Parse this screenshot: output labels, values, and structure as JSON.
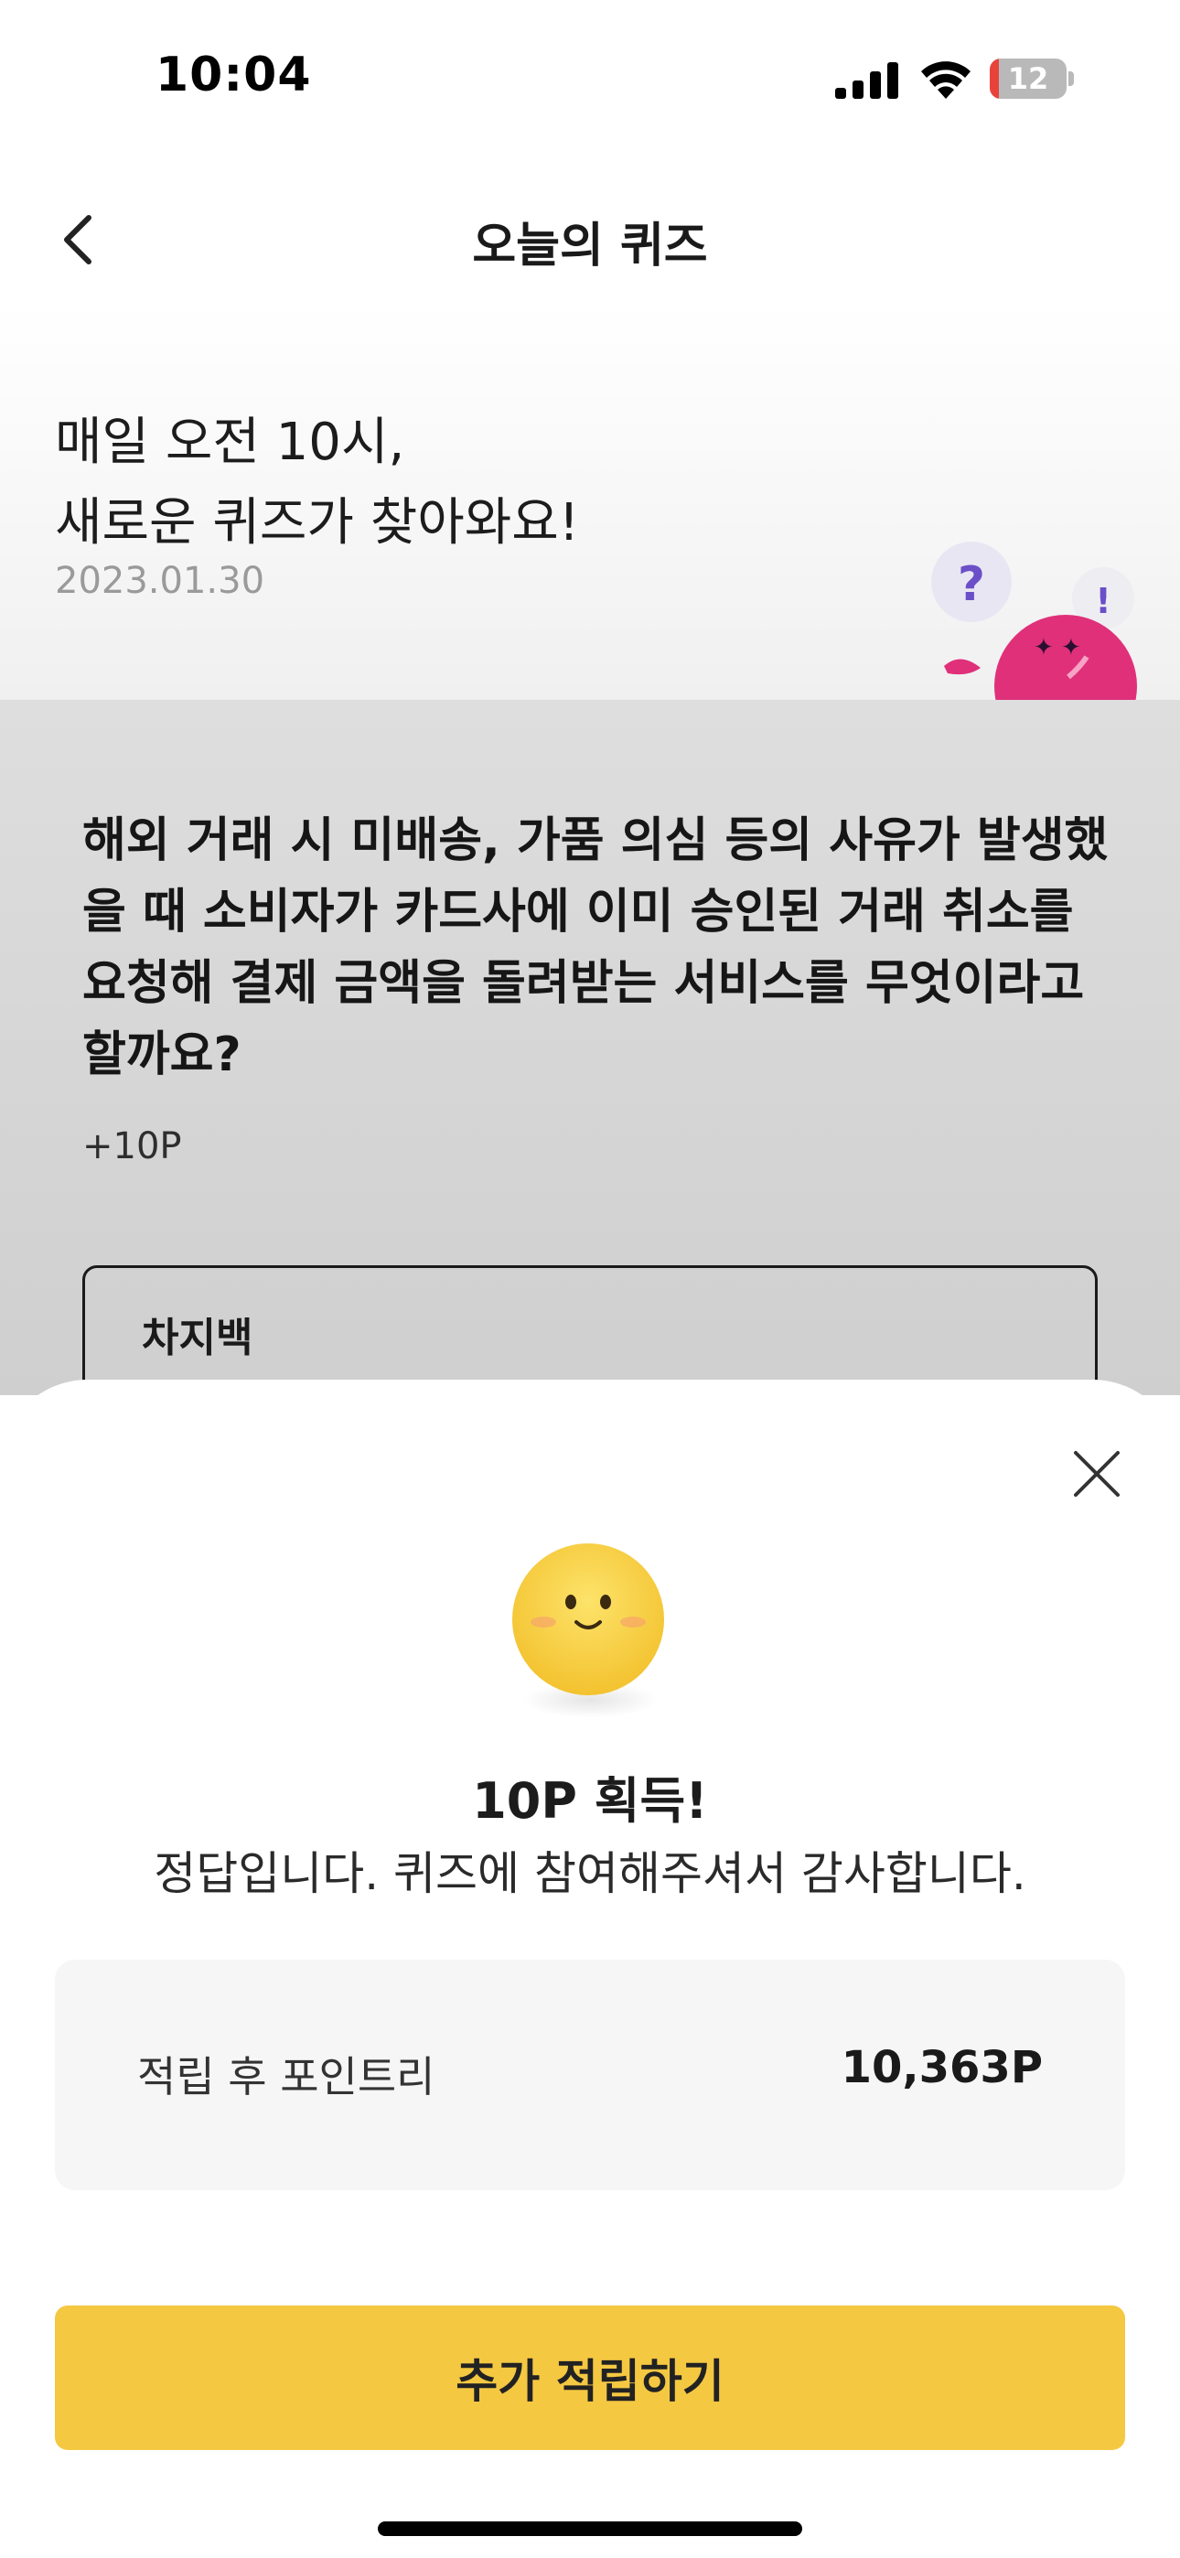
{
  "status_bar": {
    "time": "10:04",
    "battery_level": "12",
    "battery_fraction": 0.12,
    "battery_color": "#e8433b"
  },
  "nav": {
    "title": "오늘의 퀴즈",
    "back_icon": "chevron-left-icon"
  },
  "header": {
    "title_lines": [
      "매일 오전 10시,",
      "새로운 퀴즈가 찾아와요!"
    ],
    "date": "2023.01.30",
    "mascot_bubble_question": "?",
    "mascot_bubble_exclaim": "!"
  },
  "quiz": {
    "question_lines": [
      "해외 거래 시 미배송, 가품 의심 등의 사유가 발생했",
      "을 때 소비자가 카드사에 이미 승인된 거래 취소를",
      "요청해 결제 금액을 돌려받는 서비스를 무엇이라고",
      "할까요?"
    ],
    "reward": "+10P",
    "selected_answer": "차지백"
  },
  "result_sheet": {
    "close_icon": "close-icon",
    "emoji_icon": "smiley-face-icon",
    "title": "10P 획득!",
    "subtitle": "정답입니다. 퀴즈에 참여해주셔서 감사합니다.",
    "points_label": "적립 후 포인트리",
    "points_value": "10,363P",
    "cta_label": "추가 적립하기"
  },
  "colors": {
    "accent_yellow": "#f5c842",
    "mascot_pink": "#e0307a",
    "bubble_purple": "#6b4fc8"
  }
}
